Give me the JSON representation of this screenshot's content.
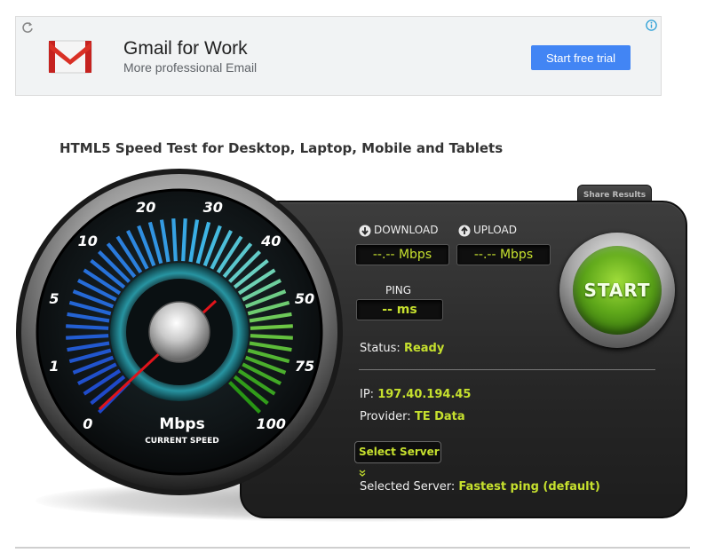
{
  "ad": {
    "title": "Gmail for Work",
    "subtitle": "More professional Email",
    "cta": "Start free trial",
    "icons": [
      "refresh-icon",
      "info-icon",
      "gmail-logo-icon"
    ]
  },
  "page": {
    "title": "HTML5 Speed Test for Desktop, Laptop, Mobile and Tablets"
  },
  "gauge": {
    "tick_labels": [
      "0",
      "1",
      "5",
      "10",
      "20",
      "30",
      "40",
      "50",
      "75",
      "100"
    ],
    "unit": "Mbps",
    "caption": "CURRENT SPEED"
  },
  "panel": {
    "share_label": "Share Results",
    "download_label": "DOWNLOAD",
    "upload_label": "UPLOAD",
    "download_value": "--.-- Mbps",
    "upload_value": "--.-- Mbps",
    "ping_label": "PING",
    "ping_value": "-- ms",
    "status_label": "Status:",
    "status_value": "Ready",
    "ip_label": "IP:",
    "ip_value": "197.40.194.45",
    "provider_label": "Provider:",
    "provider_value": "TE Data",
    "select_server_label": "Select Server",
    "selected_server_label": "Selected Server:",
    "selected_server_value": "Fastest ping (default)",
    "start_label": "START"
  },
  "colors": {
    "accent_green": "#c6e02e",
    "ad_button": "#4285f4",
    "panel": "#2a2a2a"
  }
}
